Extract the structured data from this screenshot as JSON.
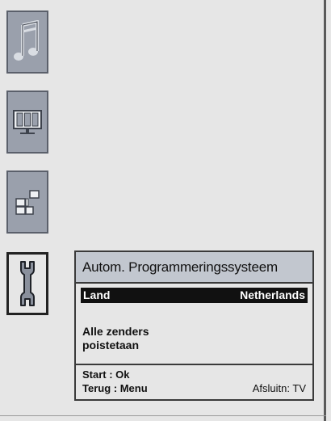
{
  "sidebar": {
    "items": [
      {
        "name": "music",
        "icon": "music-note-icon"
      },
      {
        "name": "picture",
        "icon": "tv-screen-icon"
      },
      {
        "name": "extras",
        "icon": "blocks-icon"
      },
      {
        "name": "setup",
        "icon": "wrench-icon",
        "active": true
      }
    ]
  },
  "dialog": {
    "title": "Autom. Programmeringssysteem",
    "row_label": "Land",
    "row_value": "Netherlands",
    "message_line1": "Alle zenders",
    "message_line2": "poistetaan",
    "footer_start": "Start  : Ok",
    "footer_back": "Terug : Menu",
    "footer_exit": "Afsluitn: TV"
  },
  "colors": {
    "tile_fill": "#9aa0ac",
    "tile_border": "#5b606b",
    "header_fill": "#c2c7cf",
    "highlight": "#111111",
    "background": "#e6e6e6"
  }
}
